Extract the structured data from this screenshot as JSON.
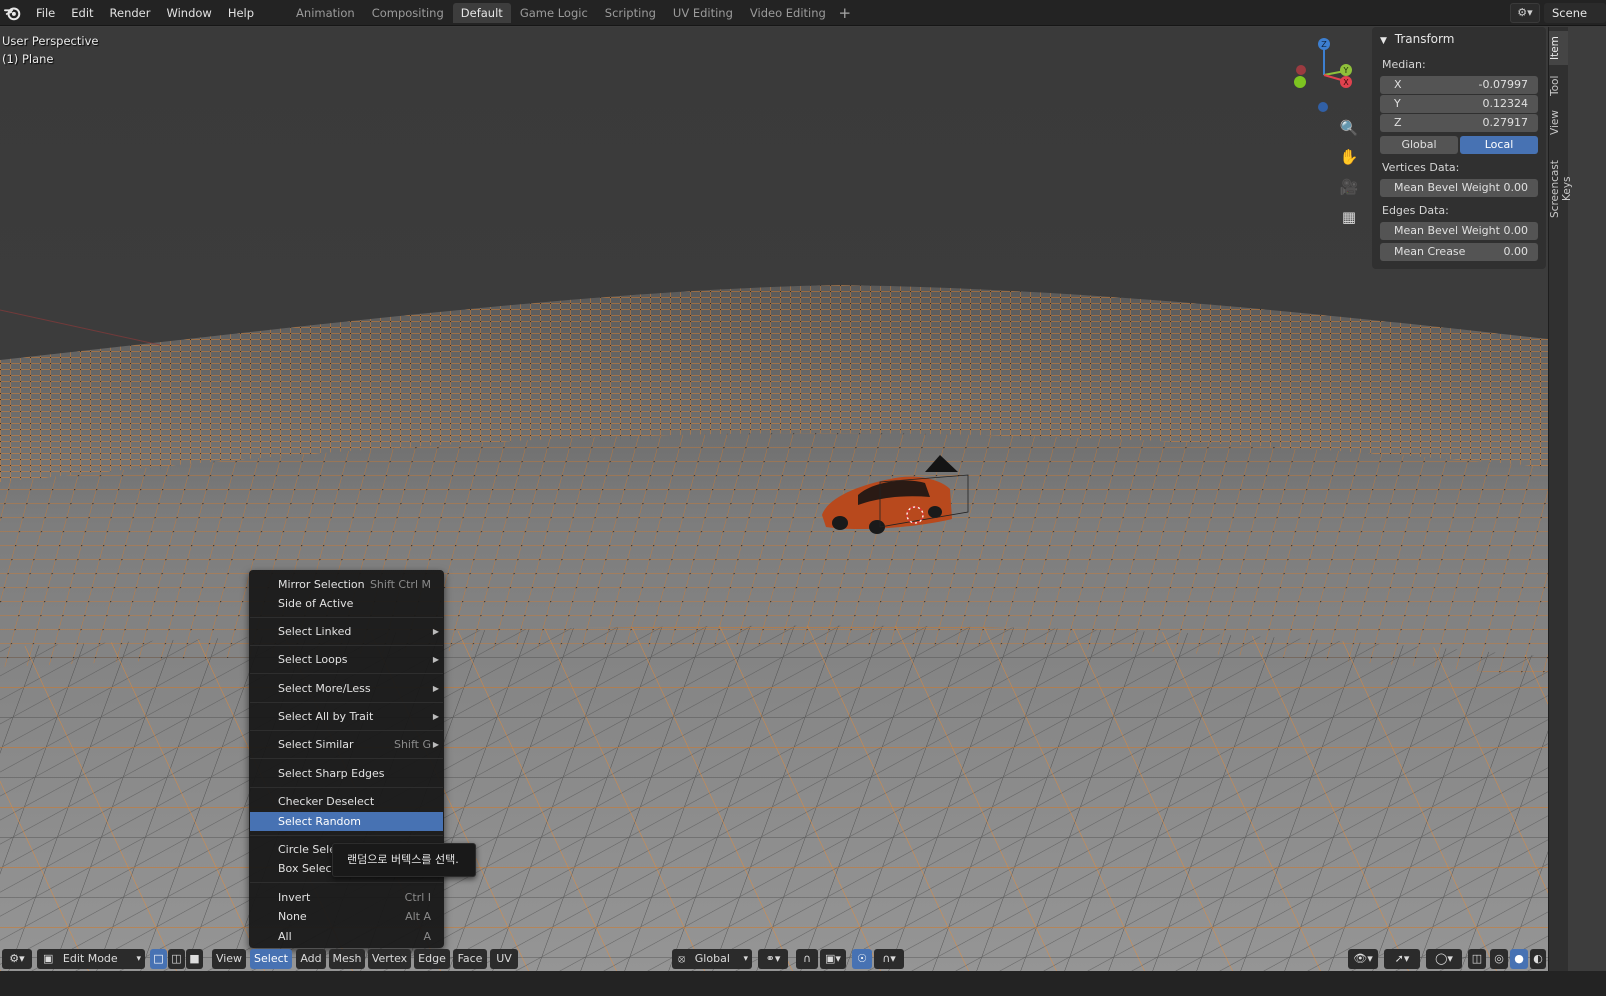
{
  "menubar": {
    "items": [
      "File",
      "Edit",
      "Render",
      "Window",
      "Help"
    ]
  },
  "workspaces": {
    "tabs": [
      "Animation",
      "Compositing",
      "Default",
      "Game Logic",
      "Scripting",
      "UV Editing",
      "Video Editing"
    ],
    "active": "Default",
    "add_label": "+"
  },
  "scene": {
    "name": "Scene"
  },
  "viewport": {
    "perspective_label": "User Perspective",
    "object_label": "(1) Plane"
  },
  "gizmo": {
    "z": "Z",
    "y": "Y",
    "x": "X"
  },
  "transform_panel": {
    "title": "Transform",
    "median_label": "Median:",
    "x": {
      "label": "X",
      "value": "-0.07997"
    },
    "y": {
      "label": "Y",
      "value": "0.12324"
    },
    "z": {
      "label": "Z",
      "value": "0.27917"
    },
    "global_label": "Global",
    "local_label": "Local",
    "vertices_label": "Vertices Data:",
    "vert_bevel": {
      "label": "Mean Bevel Weight",
      "value": "0.00"
    },
    "edges_label": "Edges Data:",
    "edge_bevel": {
      "label": "Mean Bevel Weight",
      "value": "0.00"
    },
    "crease": {
      "label": "Mean Crease",
      "value": "0.00"
    }
  },
  "sidebar_tabs": [
    "Item",
    "Tool",
    "View",
    "Screencast Keys"
  ],
  "select_menu": {
    "items": [
      {
        "label": "Mirror Selection",
        "shortcut": "Shift Ctrl M"
      },
      {
        "label": "Side of Active",
        "shortcut": ""
      },
      {
        "label": "Select Linked",
        "shortcut": ""
      },
      {
        "label": "Select Loops",
        "shortcut": ""
      },
      {
        "label": "Select More/Less",
        "shortcut": ""
      },
      {
        "label": "Select All by Trait",
        "shortcut": ""
      },
      {
        "label": "Select Similar",
        "shortcut": "Shift G"
      },
      {
        "label": "Select Sharp Edges",
        "shortcut": ""
      },
      {
        "label": "Checker Deselect",
        "shortcut": ""
      },
      {
        "label": "Select Random",
        "shortcut": ""
      },
      {
        "label": "Circle Select",
        "shortcut": ""
      },
      {
        "label": "Box Select",
        "shortcut": ""
      },
      {
        "label": "Invert",
        "shortcut": "Ctrl I"
      },
      {
        "label": "None",
        "shortcut": "Alt A"
      },
      {
        "label": "All",
        "shortcut": "A"
      }
    ],
    "tooltip": "랜덤으로 버텍스를 선택."
  },
  "header": {
    "mode": "Edit Mode",
    "menus": [
      "View",
      "Select",
      "Add",
      "Mesh",
      "Vertex",
      "Edge",
      "Face",
      "UV"
    ],
    "active_menu": "Select",
    "orientation": "Global"
  },
  "colors": {
    "accent": "#4772b3",
    "wire_selected": "#ff8a1f",
    "mesh_gray": "#8f8f8f"
  }
}
